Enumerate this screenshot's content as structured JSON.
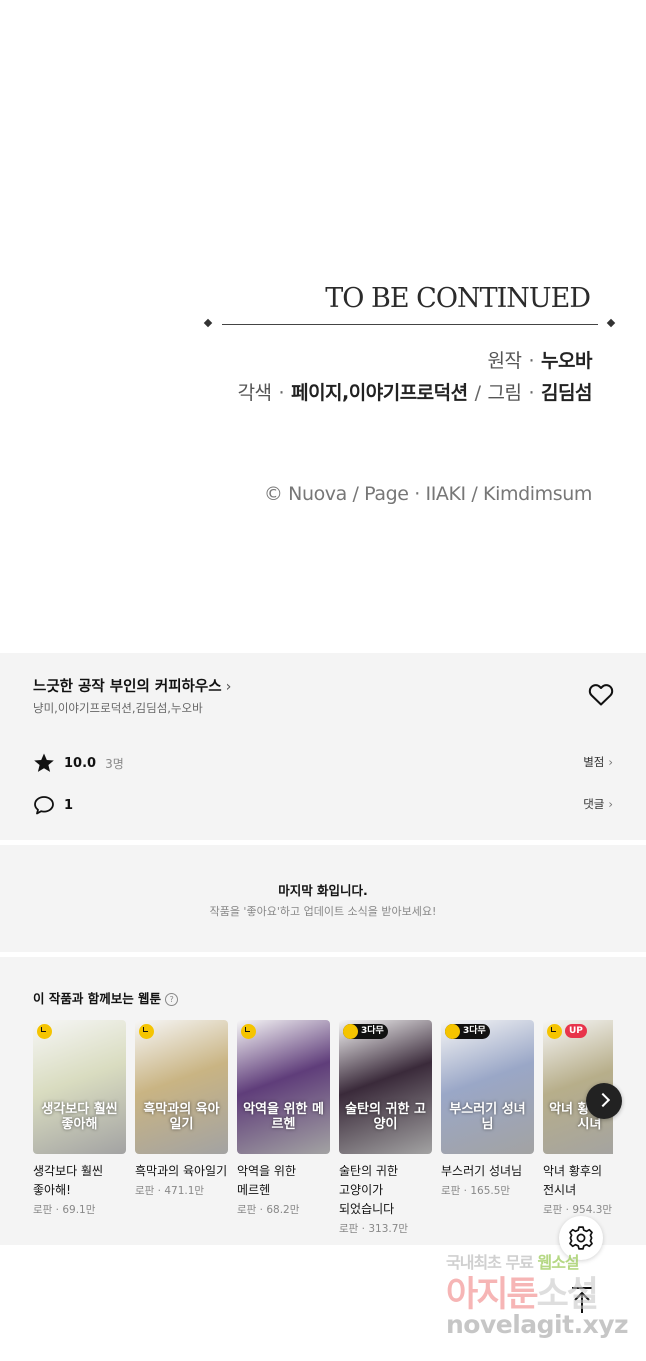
{
  "ending": {
    "tbc": "TO BE CONTINUED",
    "original_label": "원작",
    "original_author": "누오바",
    "adapt_label": "각색",
    "adapt_author": "페이지,이야기프로덕션",
    "art_label": "그림",
    "art_author": "김딤섬",
    "copyright": "© Nuova / Page · IIAKI / Kimdimsum"
  },
  "series": {
    "title": "느긋한 공작 부인의 커피하우스",
    "chevron": "›",
    "authors": "냥미,이야기프로덕션,김딤섬,누오바",
    "like_icon": "heart-outline-icon"
  },
  "rating": {
    "score": "10.0",
    "count": "3명",
    "link": "별점",
    "icon": "star-icon"
  },
  "comments": {
    "count": "1",
    "link": "댓글",
    "icon": "comment-bubble-icon"
  },
  "notice": {
    "title": "마지막 화입니다.",
    "subtitle": "작품을 '좋아요'하고 업데이트 소식을 받아보세요!"
  },
  "recommend": {
    "title": "이 작품과 함께보는 웹툰",
    "help_icon": "question-circle-icon",
    "items": [
      {
        "title": "생각보다 훨씬 좋아해!",
        "meta": "로판 · 69.1만",
        "badge": "clock",
        "cover_text": "생각보다 훨씬 좋아해",
        "bg": "#d9dcc0"
      },
      {
        "title": "흑막과의 육아일기",
        "meta": "로판 · 471.1만",
        "badge": "clock",
        "cover_text": "흑막과의 육아일기",
        "bg": "#c9b483"
      },
      {
        "title": "악역을 위한 메르헨",
        "meta": "로판 · 68.2만",
        "badge": "clock",
        "cover_text": "악역을 위한 메르헨",
        "bg": "#5f3d7a"
      },
      {
        "title": "술탄의 귀한 고양이가 되었습니다",
        "meta": "로판 · 313.7만",
        "badge": "3다무",
        "cover_text": "술탄의 귀한 고양이",
        "bg": "#3a2a3a"
      },
      {
        "title": "부스러기 성녀님",
        "meta": "로판 · 165.5만",
        "badge": "3다무",
        "cover_text": "부스러기 성녀님",
        "bg": "#9aa7c7"
      },
      {
        "title": "악녀 황후의 전시녀",
        "meta": "로판 · 954.3만",
        "badge": "UP",
        "cover_text": "악녀 황후의 전 시녀",
        "bg": "#b7ae8a"
      }
    ],
    "next_icon": "chevron-right-icon"
  },
  "floating": {
    "settings_icon": "gear-icon",
    "top_icon": "arrow-up-icon"
  },
  "watermark": {
    "line1_a": "국내최초 무료",
    "line1_b": "웹소설",
    "line2_a": "아지툰",
    "line2_b": "소설",
    "line3": "novelagit.xyz"
  }
}
